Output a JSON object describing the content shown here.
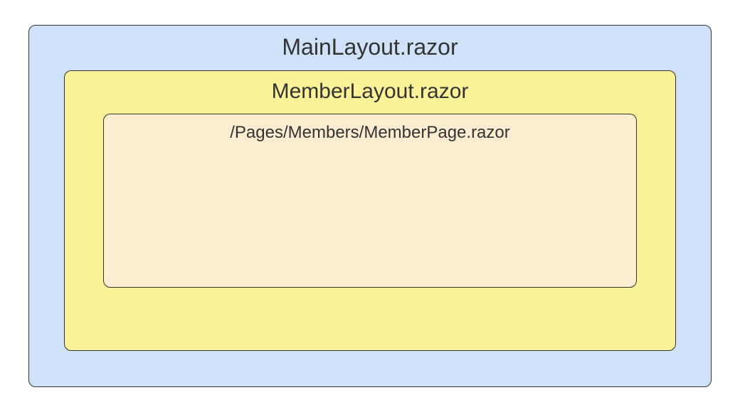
{
  "diagram": {
    "outer": {
      "label": "MainLayout.razor",
      "bg": "#cfe2f9"
    },
    "middle": {
      "label": "MemberLayout.razor",
      "bg": "#fcf399"
    },
    "inner": {
      "label": "/Pages/Members/MemberPage.razor",
      "bg": "#fcecd0"
    }
  }
}
